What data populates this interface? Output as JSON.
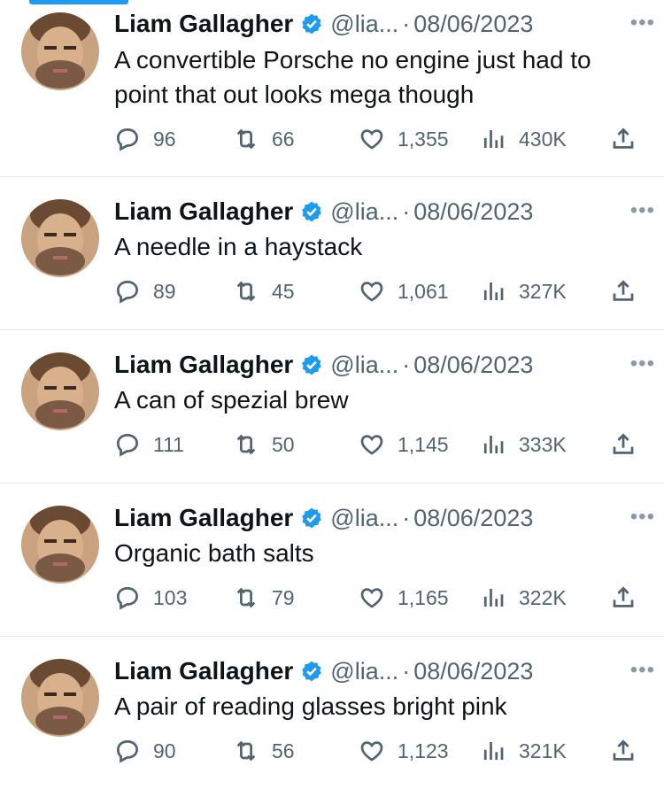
{
  "colors": {
    "accent": "#1d9bf0",
    "text": "#0f1419",
    "muted": "#536471"
  },
  "icons": {
    "reply": "reply-icon",
    "retweet": "retweet-icon",
    "like": "heart-icon",
    "views": "views-icon",
    "share": "share-icon",
    "verified": "verified-badge-icon",
    "more": "more-icon"
  },
  "tweets": [
    {
      "name": "Liam Gallagher",
      "handle": "@lia...",
      "separator": "·",
      "date": "08/06/2023",
      "text": "A convertible Porsche no engine just had to point that out looks mega though",
      "replies": "96",
      "retweets": "66",
      "likes": "1,355",
      "views": "430K"
    },
    {
      "name": "Liam Gallagher",
      "handle": "@lia...",
      "separator": "·",
      "date": "08/06/2023",
      "text": "A needle in a haystack",
      "replies": "89",
      "retweets": "45",
      "likes": "1,061",
      "views": "327K"
    },
    {
      "name": "Liam Gallagher",
      "handle": "@lia...",
      "separator": "·",
      "date": "08/06/2023",
      "text": "A can of spezial brew",
      "replies": "111",
      "retweets": "50",
      "likes": "1,145",
      "views": "333K"
    },
    {
      "name": "Liam Gallagher",
      "handle": "@lia...",
      "separator": "·",
      "date": "08/06/2023",
      "text": "Organic bath salts",
      "replies": "103",
      "retweets": "79",
      "likes": "1,165",
      "views": "322K"
    },
    {
      "name": "Liam Gallagher",
      "handle": "@lia...",
      "separator": "·",
      "date": "08/06/2023",
      "text": "A pair of reading glasses bright pink",
      "replies": "90",
      "retweets": "56",
      "likes": "1,123",
      "views": "321K"
    }
  ]
}
